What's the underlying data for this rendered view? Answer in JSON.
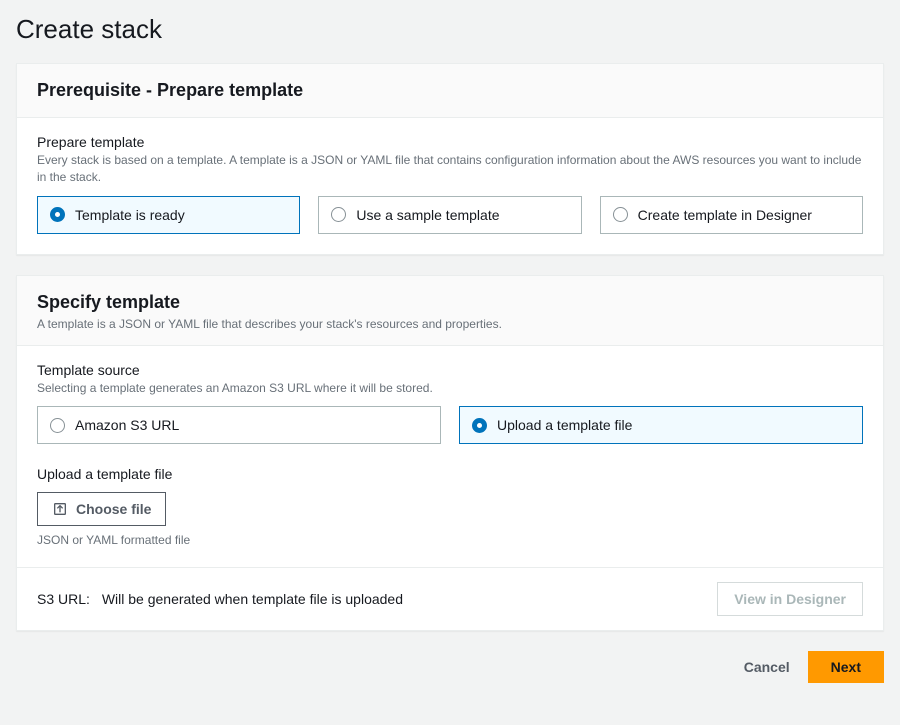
{
  "page": {
    "title": "Create stack"
  },
  "prereq": {
    "header": "Prerequisite - Prepare template",
    "field_label": "Prepare template",
    "field_desc": "Every stack is based on a template. A template is a JSON or YAML file that contains configuration information about the AWS resources you want to include in the stack.",
    "options": [
      "Template is ready",
      "Use a sample template",
      "Create template in Designer"
    ]
  },
  "specify": {
    "header": "Specify template",
    "header_desc": "A template is a JSON or YAML file that describes your stack's resources and properties.",
    "source_label": "Template source",
    "source_desc": "Selecting a template generates an Amazon S3 URL where it will be stored.",
    "source_options": [
      "Amazon S3 URL",
      "Upload a template file"
    ],
    "upload_label": "Upload a template file",
    "choose_file": "Choose file",
    "file_hint": "JSON or YAML formatted file",
    "s3_label": "S3 URL:",
    "s3_value": "Will be generated when template file is uploaded",
    "view_designer": "View in Designer"
  },
  "footer": {
    "cancel": "Cancel",
    "next": "Next"
  }
}
